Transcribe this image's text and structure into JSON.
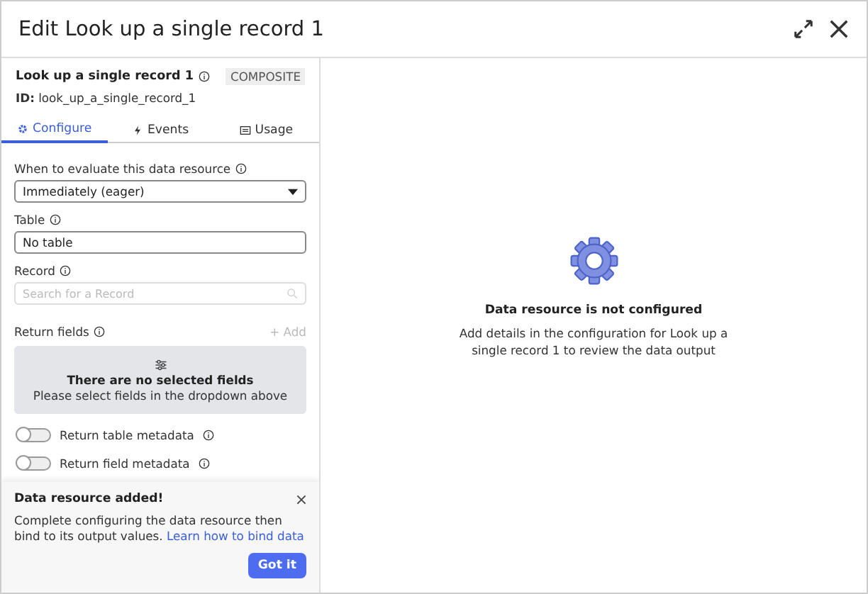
{
  "window": {
    "title": "Edit Look up a single record 1"
  },
  "resource": {
    "name": "Look up a single record 1",
    "badge": "COMPOSITE",
    "id_label": "ID:",
    "id_value": "look_up_a_single_record_1"
  },
  "tabs": [
    {
      "label": "Configure",
      "selected": true
    },
    {
      "label": "Events",
      "selected": false
    },
    {
      "label": "Usage",
      "selected": false
    }
  ],
  "form": {
    "evaluate": {
      "label": "When to evaluate this data resource",
      "value": "Immediately (eager)"
    },
    "table": {
      "label": "Table",
      "value": "No table"
    },
    "record": {
      "label": "Record",
      "placeholder": "Search for a Record"
    },
    "return_fields": {
      "label": "Return fields",
      "add": "+ Add",
      "empty_title": "There are no selected fields",
      "empty_text": "Please select fields in the dropdown above"
    },
    "toggles": [
      {
        "label": "Return table metadata",
        "on": false
      },
      {
        "label": "Return field metadata",
        "on": false
      }
    ]
  },
  "toast": {
    "title": "Data resource added!",
    "text": "Complete configuring the data resource then bind to its output values.",
    "link": "Learn how to bind data",
    "button": "Got it"
  },
  "empty_state": {
    "title": "Data resource is not configured",
    "text": "Add details in the configuration for Look up a single record 1 to review the data output"
  }
}
